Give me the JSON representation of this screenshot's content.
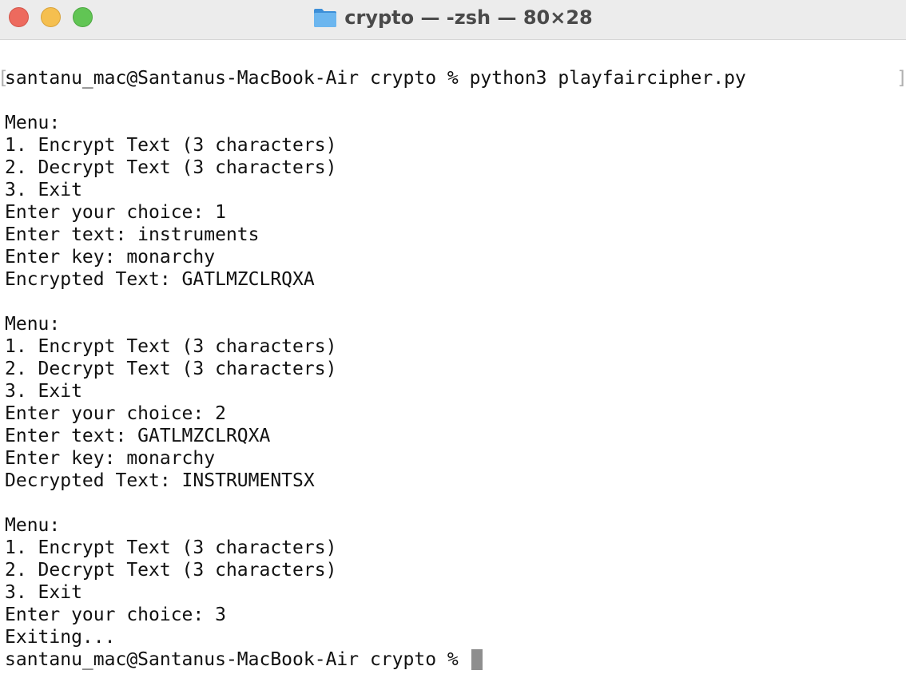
{
  "window": {
    "title": "crypto — -zsh — 80×28",
    "folder_icon": "folder-icon",
    "controls": {
      "close": "close-icon",
      "minimize": "minimize-icon",
      "zoom": "zoom-icon"
    },
    "colors": {
      "close": "#ed6a5e",
      "minimize": "#f5bf4f",
      "zoom": "#61c554",
      "folder": "#5aa9e6"
    }
  },
  "terminal": {
    "bracket_left": "[",
    "bracket_right": "]",
    "lines": [
      "santanu_mac@Santanus-MacBook-Air crypto % python3 playfaircipher.py",
      "",
      "Menu:",
      "1. Encrypt Text (3 characters)",
      "2. Decrypt Text (3 characters)",
      "3. Exit",
      "Enter your choice: 1",
      "Enter text: instruments",
      "Enter key: monarchy",
      "Encrypted Text: GATLMZCLRQXA",
      "",
      "Menu:",
      "1. Encrypt Text (3 characters)",
      "2. Decrypt Text (3 characters)",
      "3. Exit",
      "Enter your choice: 2",
      "Enter text: GATLMZCLRQXA",
      "Enter key: monarchy",
      "Decrypted Text: INSTRUMENTSX",
      "",
      "Menu:",
      "1. Encrypt Text (3 characters)",
      "2. Decrypt Text (3 characters)",
      "3. Exit",
      "Enter your choice: 3",
      "Exiting...",
      "santanu_mac@Santanus-MacBook-Air crypto % "
    ]
  }
}
